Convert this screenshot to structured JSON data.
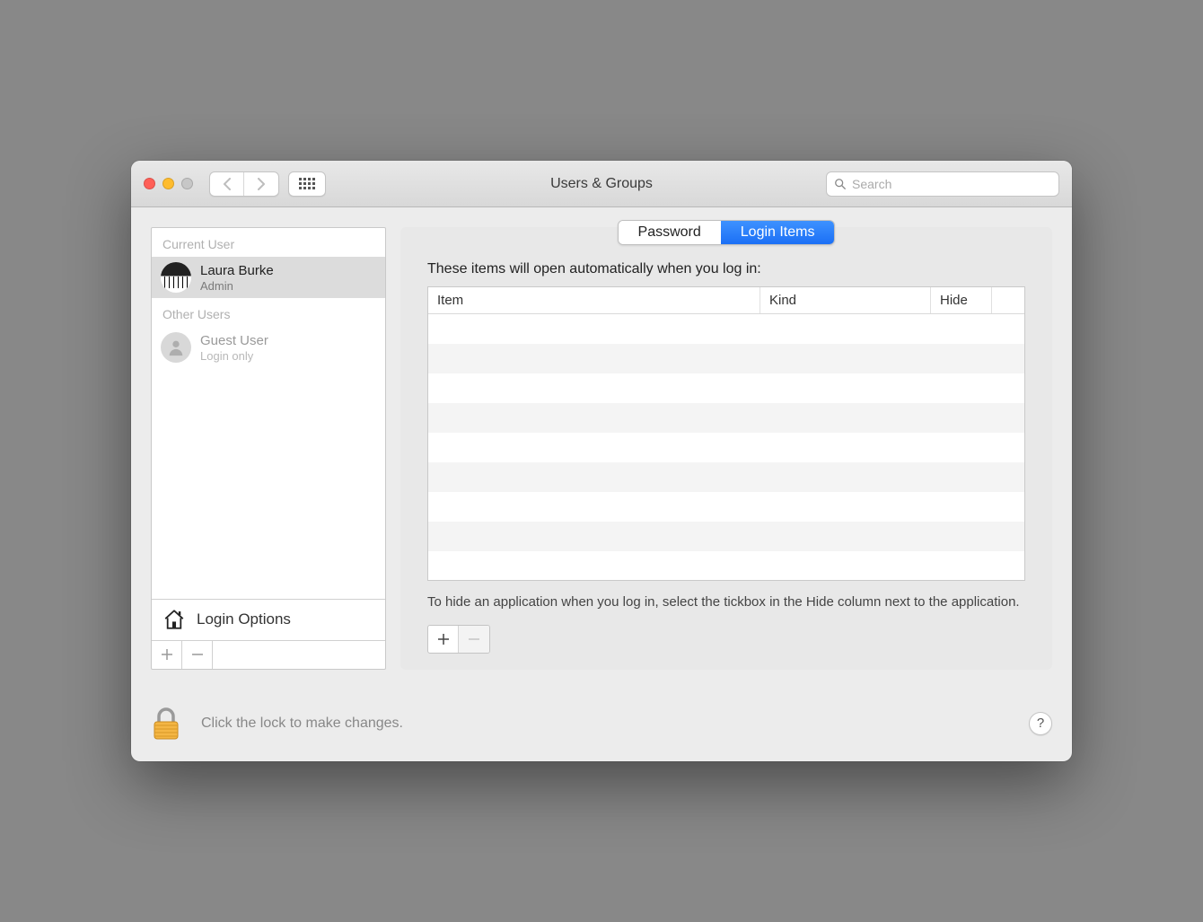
{
  "window": {
    "title": "Users & Groups",
    "search_placeholder": "Search"
  },
  "sidebar": {
    "current_user_label": "Current User",
    "other_users_label": "Other Users",
    "current_user": {
      "name": "Laura Burke",
      "role": "Admin"
    },
    "other_users": [
      {
        "name": "Guest User",
        "role": "Login only"
      }
    ],
    "login_options_label": "Login Options"
  },
  "main": {
    "tabs": {
      "password": "Password",
      "login_items": "Login Items"
    },
    "lead_text": "These items will open automatically when you log in:",
    "columns": {
      "item": "Item",
      "kind": "Kind",
      "hide": "Hide"
    },
    "hint_text": "To hide an application when you log in, select the tickbox in the Hide column next to the application."
  },
  "footer": {
    "lock_text": "Click the lock to make changes.",
    "help_label": "?"
  }
}
